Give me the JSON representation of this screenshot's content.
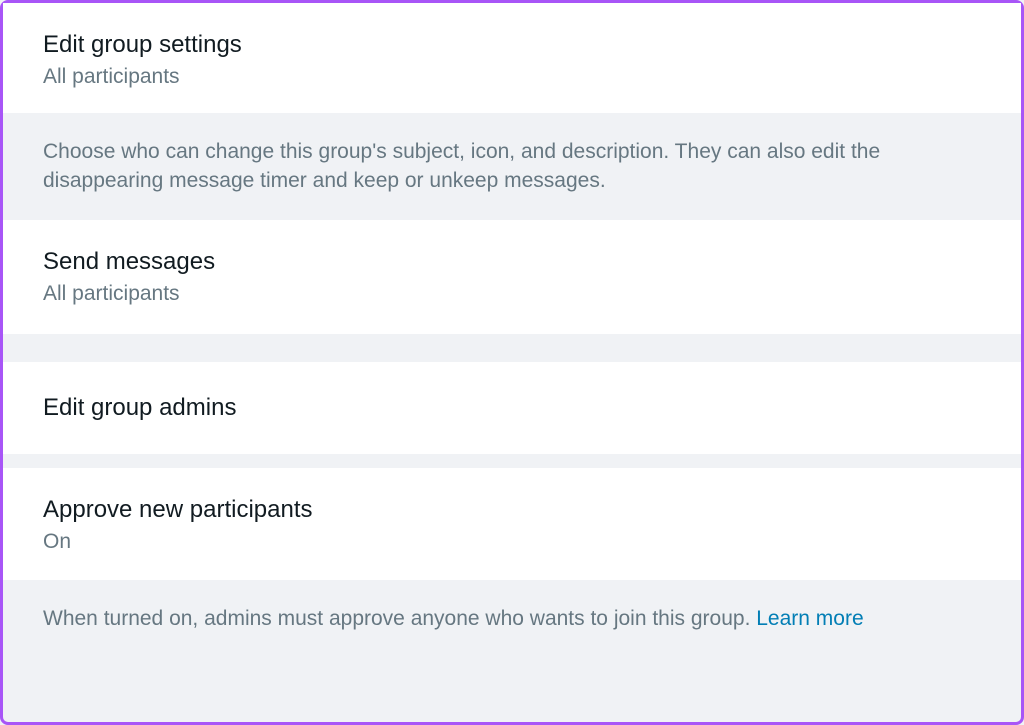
{
  "settings": {
    "editGroupSettings": {
      "title": "Edit group settings",
      "subtitle": "All participants",
      "description": "Choose who can change this group's subject, icon, and description. They can also edit the disappearing message timer and keep or unkeep messages."
    },
    "sendMessages": {
      "title": "Send messages",
      "subtitle": "All participants"
    },
    "editGroupAdmins": {
      "title": "Edit group admins"
    },
    "approveParticipants": {
      "title": "Approve new participants",
      "subtitle": "On",
      "description": "When turned on, admins must approve anyone who wants to join this group. ",
      "learnMore": "Learn more"
    }
  }
}
